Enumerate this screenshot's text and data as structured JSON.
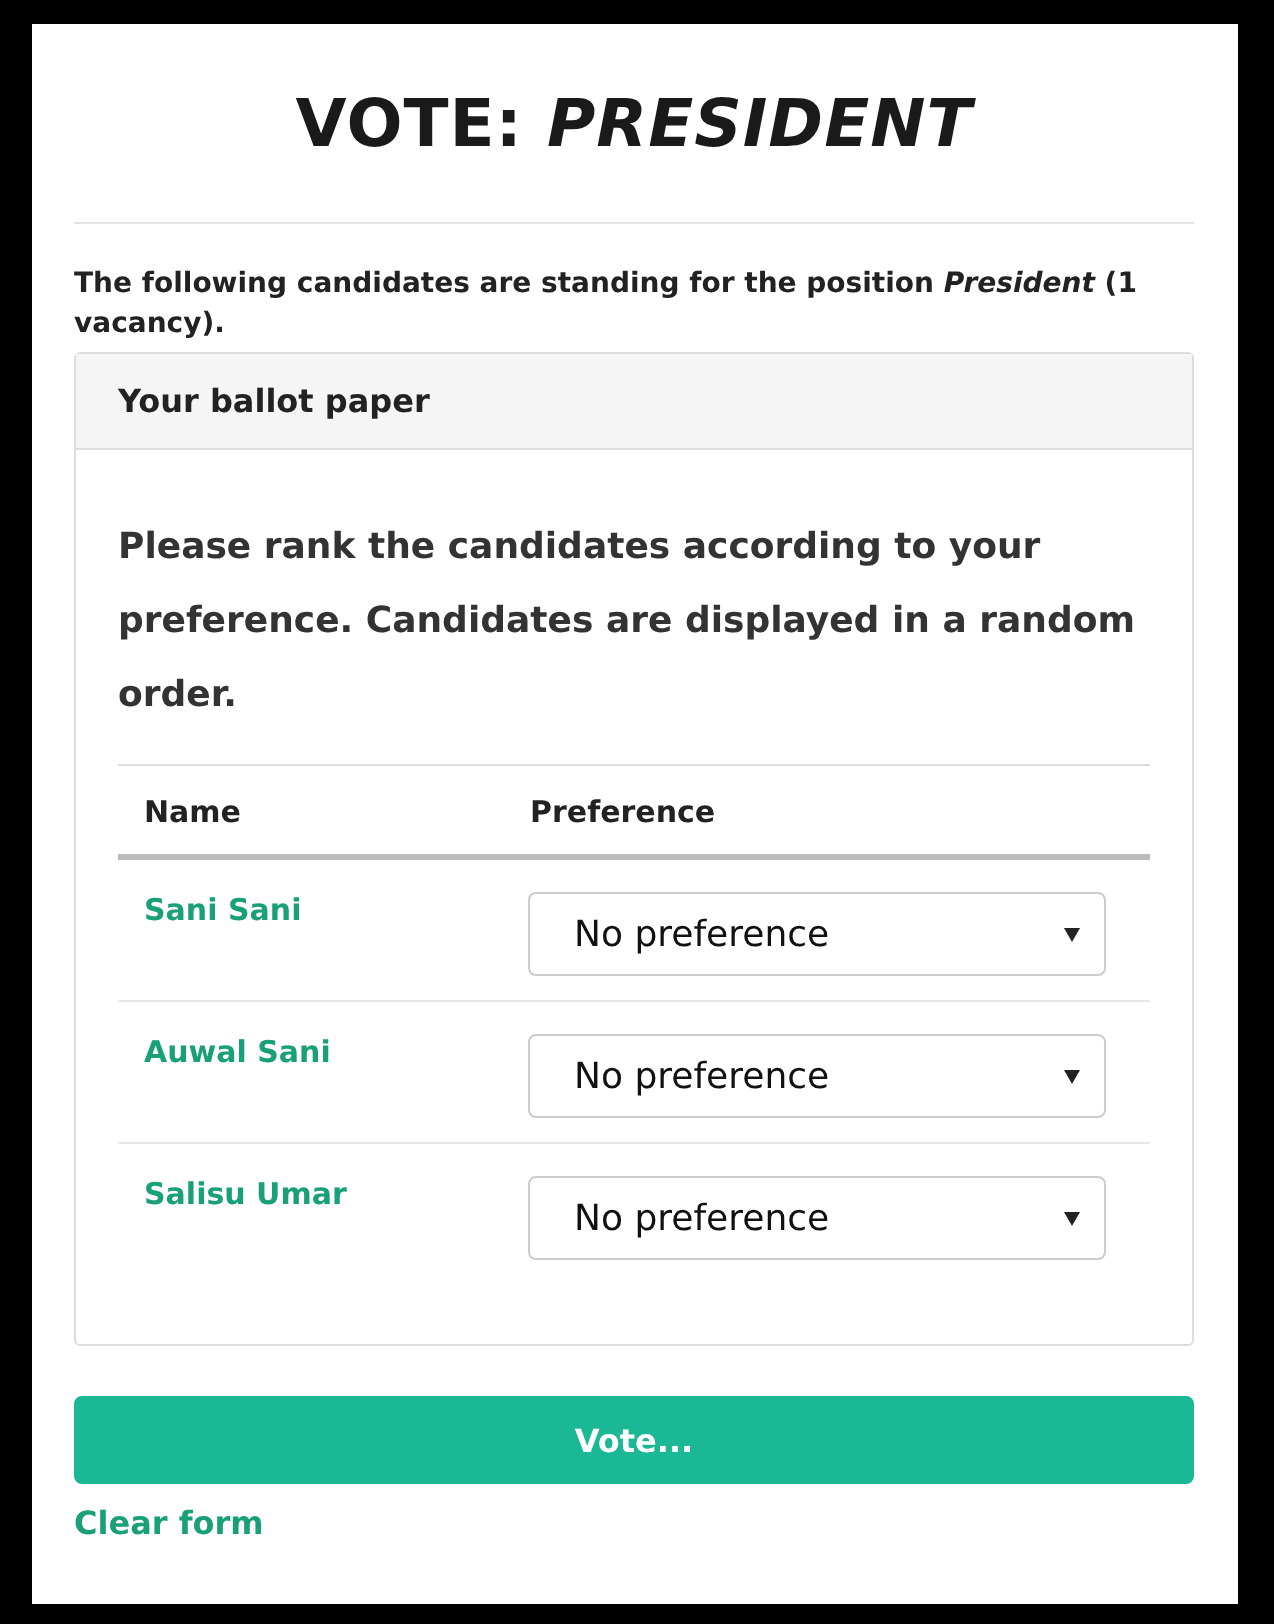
{
  "title": "VOTE: *PRESIDENT*",
  "intro": "The following candidates are standing for the position *President* (1 vacancy).",
  "ballot": {
    "header": "Your ballot paper",
    "instructions": "Please rank the candidates according to your preference. Candidates are displayed in a random order.",
    "columns": [
      "Name",
      "Preference"
    ],
    "rows": [
      {
        "name": "Sani Sani",
        "preference": "No preference"
      },
      {
        "name": "Auwal Sani",
        "preference": "No preference"
      },
      {
        "name": "Salisu Umar",
        "preference": "No preference"
      }
    ]
  },
  "buttons": {
    "vote": "Vote...",
    "clear": "Clear form"
  }
}
